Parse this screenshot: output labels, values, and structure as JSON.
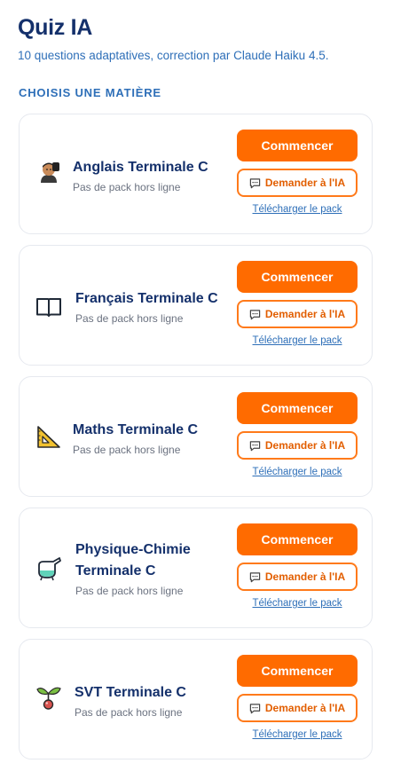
{
  "header": {
    "title": "Quiz IA",
    "subtitle": "10 questions adaptatives, correction par Claude Haiku 4.5."
  },
  "section_label": "CHOISIS UNE MATIÈRE",
  "subjects": [
    {
      "name": "Anglais Terminale C",
      "icon": "guard-icon",
      "pack_status": "Pas de pack hors ligne",
      "start_label": "Commencer",
      "ask_label": "Demander à l'IA",
      "download_label": "Télécharger le pack"
    },
    {
      "name": "Français Terminale C",
      "icon": "open-book-icon",
      "pack_status": "Pas de pack hors ligne",
      "start_label": "Commencer",
      "ask_label": "Demander à l'IA",
      "download_label": "Télécharger le pack"
    },
    {
      "name": "Maths Terminale C",
      "icon": "triangle-ruler-icon",
      "pack_status": "Pas de pack hors ligne",
      "start_label": "Commencer",
      "ask_label": "Demander à l'IA",
      "download_label": "Télécharger le pack"
    },
    {
      "name": "Physique-Chimie Terminale C",
      "icon": "flask-icon",
      "pack_status": "Pas de pack hors ligne",
      "start_label": "Commencer",
      "ask_label": "Demander à l'IA",
      "download_label": "Télécharger le pack"
    },
    {
      "name": "SVT Terminale C",
      "icon": "seedling-icon",
      "pack_status": "Pas de pack hors ligne",
      "start_label": "Commencer",
      "ask_label": "Demander à l'IA",
      "download_label": "Télécharger le pack"
    }
  ],
  "colors": {
    "primary": "#ff6b00",
    "title": "#14306b",
    "accent_blue": "#2e6fb8",
    "muted": "#6b7280"
  }
}
